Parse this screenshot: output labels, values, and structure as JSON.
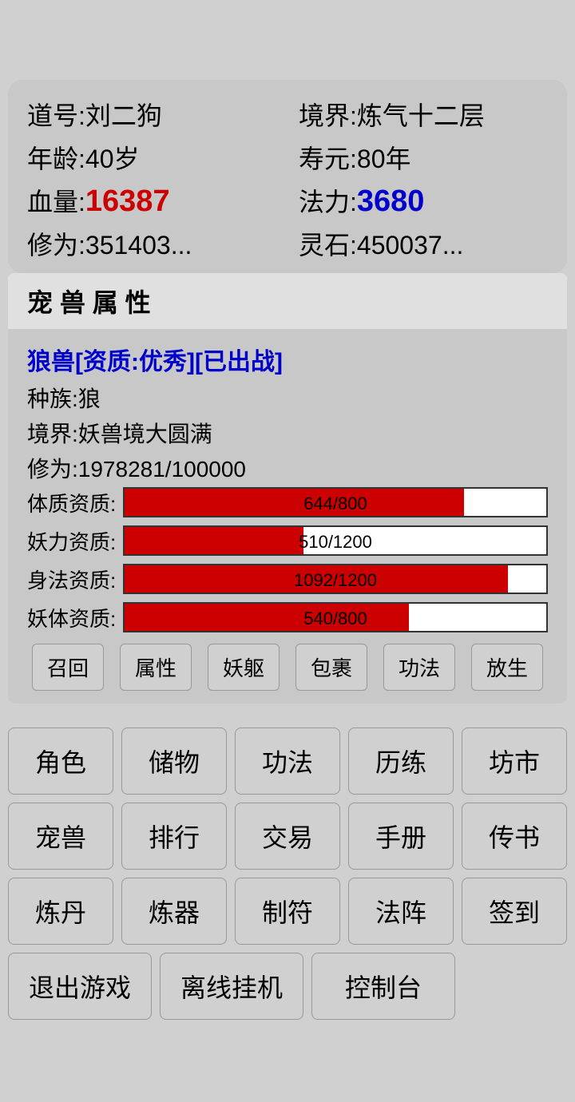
{
  "character": {
    "dao_label": "道号:",
    "dao_value": "刘二狗",
    "realm_label": "境界:",
    "realm_value": "炼气十二层",
    "age_label": "年龄:",
    "age_value": "40岁",
    "lifespan_label": "寿元:",
    "lifespan_value": "80年",
    "blood_label": "血量:",
    "blood_value": "16387",
    "mana_label": "法力:",
    "mana_value": "3680",
    "cultivation_label": "修为:",
    "cultivation_value": "351403...",
    "spirit_label": "灵石:",
    "spirit_value": "450037..."
  },
  "pet_panel": {
    "header": "宠 兽 属 性",
    "name": "狼兽[资质:优秀][已出战]",
    "race_label": "种族:",
    "race_value": "狼",
    "realm_label": "境界:",
    "realm_value": "妖兽境大圆满",
    "cultivation_label": "修为:",
    "cultivation_value": "1978281/100000",
    "stats": [
      {
        "label": "体质资质:",
        "current": 644,
        "max": 800,
        "text": "644/800"
      },
      {
        "label": "妖力资质:",
        "current": 510,
        "max": 1200,
        "text": "510/1200"
      },
      {
        "label": "身法资质:",
        "current": 1092,
        "max": 1200,
        "text": "1092/1200"
      },
      {
        "label": "妖体资质:",
        "current": 540,
        "max": 800,
        "text": "540/800"
      }
    ],
    "buttons": [
      "召回",
      "属性",
      "妖躯",
      "包裹",
      "功法",
      "放生"
    ]
  },
  "main_menu": {
    "rows": [
      [
        "角色",
        "储物",
        "功法",
        "历练",
        "坊市"
      ],
      [
        "宠兽",
        "排行",
        "交易",
        "手册",
        "传书"
      ],
      [
        "炼丹",
        "炼器",
        "制符",
        "法阵",
        "签到"
      ],
      [
        "退出游戏",
        "离线挂机",
        "控制台"
      ]
    ]
  }
}
